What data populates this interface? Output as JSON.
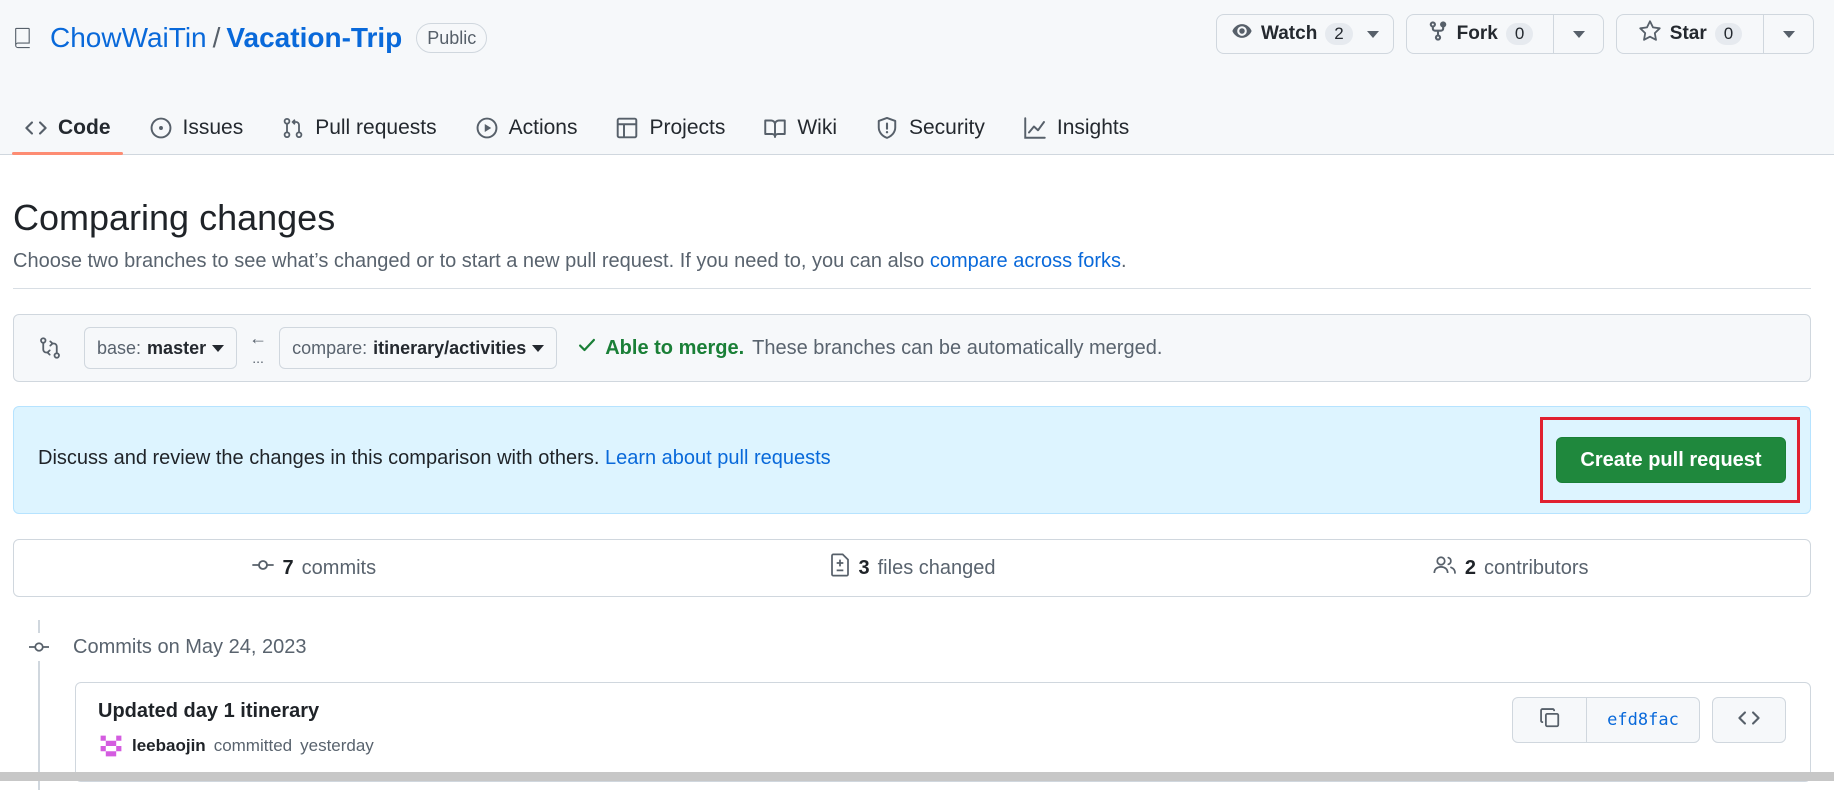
{
  "repo": {
    "owner": "ChowWaiTin",
    "separator": "/",
    "name": "Vacation-Trip",
    "visibility": "Public",
    "icon": "repo-icon"
  },
  "actions": {
    "watch": {
      "label": "Watch",
      "count": "2",
      "icon": "eye-icon"
    },
    "fork": {
      "label": "Fork",
      "count": "0",
      "icon": "fork-icon"
    },
    "star": {
      "label": "Star",
      "count": "0",
      "icon": "star-icon"
    }
  },
  "tabs": [
    {
      "label": "Code",
      "icon": "code-icon",
      "selected": true
    },
    {
      "label": "Issues",
      "icon": "issue-icon"
    },
    {
      "label": "Pull requests",
      "icon": "pull-request-icon"
    },
    {
      "label": "Actions",
      "icon": "play-icon"
    },
    {
      "label": "Projects",
      "icon": "table-icon"
    },
    {
      "label": "Wiki",
      "icon": "book-icon"
    },
    {
      "label": "Security",
      "icon": "shield-icon"
    },
    {
      "label": "Insights",
      "icon": "graph-icon"
    }
  ],
  "page": {
    "title": "Comparing changes",
    "subtitle": "Choose two branches to see what’s changed or to start a new pull request. If you need to, you can also ",
    "subtitle_link": "compare across forks",
    "subtitle_end": "."
  },
  "range": {
    "base_prefix": "base:",
    "base_branch": "master",
    "compare_prefix": "compare:",
    "compare_branch": "itinerary/activities",
    "arrow": "←",
    "ellipsis": "...",
    "merge_status": "Able to merge.",
    "merge_detail": "These branches can be automatically merged."
  },
  "info": {
    "text": "Discuss and review the changes in this comparison with others.",
    "link": "Learn about pull requests",
    "button": "Create pull request"
  },
  "summary": {
    "commits_count": "7",
    "commits_label": "commits",
    "files_count": "3",
    "files_label": "files changed",
    "contributors_count": "2",
    "contributors_label": "contributors"
  },
  "timeline": {
    "heading": "Commits on May 24, 2023"
  },
  "commit": {
    "title": "Updated day 1 itinerary",
    "author": "leebaojin",
    "action": "committed",
    "time": "yesterday",
    "sha": "efd8fac"
  },
  "colors": {
    "accent": "#0969da",
    "success": "#1a7f37",
    "primary_button": "#1f883d",
    "highlight": "#e02030",
    "tab_underline": "#fd8c73"
  }
}
